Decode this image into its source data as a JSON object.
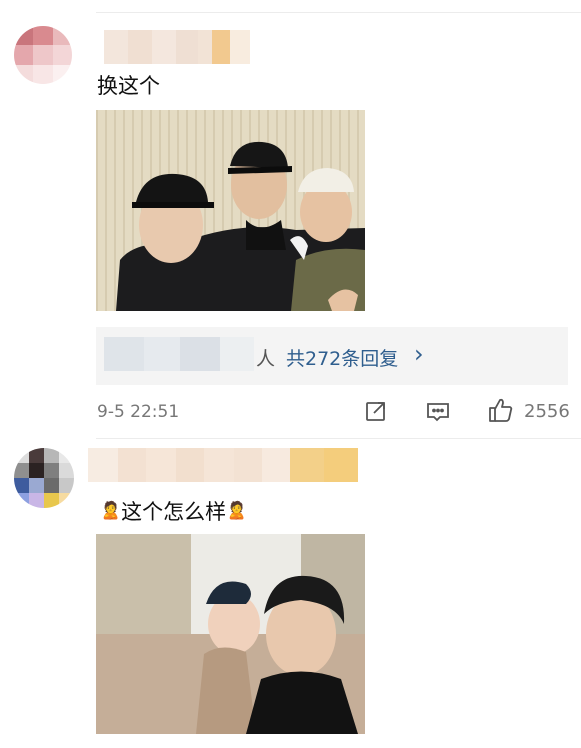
{
  "comments": [
    {
      "text": "换这个",
      "time": "9-5 22:51",
      "reply_suffix": "人",
      "reply_link": "共272条回复",
      "reply_chevron": "›",
      "likes": "2556"
    },
    {
      "text": "这个怎么样",
      "emoji_left": "🙎",
      "emoji_right": "🙎"
    }
  ],
  "colors": {
    "link": "#2f5e8e",
    "meta": "#777777",
    "divider": "#ececec"
  },
  "icons": [
    "share-icon",
    "comment-icon",
    "thumbs-up-icon",
    "chevron-right-icon"
  ]
}
